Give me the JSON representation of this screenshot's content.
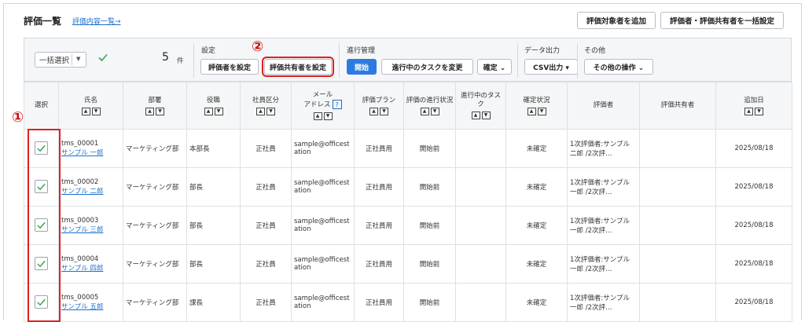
{
  "header": {
    "title": "評価一覧",
    "link": "評価内容一覧→",
    "add_targets_button": "評価対象者を追加",
    "bulk_settings_button": "評価者・評価共有者を一括設定"
  },
  "toolbar": {
    "bulk_select": "一括選択",
    "count": "5",
    "count_unit": "件",
    "settings_label": "設定",
    "set_evaluator_button": "評価者を設定",
    "set_sharer_button": "評価共有者を設定",
    "progress_label": "進行管理",
    "start_button": "開始",
    "change_task_button": "進行中のタスクを変更",
    "confirm_button": "確定 ⌄",
    "data_output_label": "データ出力",
    "csv_button": "CSV出力 ▾",
    "other_label": "その他",
    "other_ops_button": "その他の操作 ⌄"
  },
  "markers": {
    "one": "①",
    "two": "②"
  },
  "columns": {
    "select": "選択",
    "name": "氏名",
    "dept": "部署",
    "position": "役職",
    "emp_type": "社員区分",
    "email_a": "メール",
    "email_b": "アドレス",
    "plan": "評価プラン",
    "eval_status": "評価の進行状況",
    "task": "進行中のタスク",
    "confirm_status": "確定状況",
    "evaluator": "評価者",
    "sharer": "評価共有者",
    "added_date": "追加日"
  },
  "rows": [
    {
      "id": "tms_00001",
      "name": "サンプル 一郎",
      "dept": "マーケティング部",
      "position": "本部長",
      "emp_type": "正社員",
      "email": "sample@officestation",
      "plan": "正社員用",
      "eval_status": "開始前",
      "task": "",
      "confirm": "未確定",
      "evaluator": "1次評価者:サンプル 二郎 /2次評…",
      "sharer": "",
      "added": "2025/08/18"
    },
    {
      "id": "tms_00002",
      "name": "サンプル 二郎",
      "dept": "マーケティング部",
      "position": "部長",
      "emp_type": "正社員",
      "email": "sample@officestation",
      "plan": "正社員用",
      "eval_status": "開始前",
      "task": "",
      "confirm": "未確定",
      "evaluator": "1次評価者:サンプル 一郎 /2次評…",
      "sharer": "",
      "added": "2025/08/18"
    },
    {
      "id": "tms_00003",
      "name": "サンプル 三郎",
      "dept": "マーケティング部",
      "position": "部長",
      "emp_type": "正社員",
      "email": "sample@officestation",
      "plan": "正社員用",
      "eval_status": "開始前",
      "task": "",
      "confirm": "未確定",
      "evaluator": "1次評価者:サンプル 一郎 /2次評…",
      "sharer": "",
      "added": "2025/08/18"
    },
    {
      "id": "tms_00004",
      "name": "サンプル 四郎",
      "dept": "マーケティング部",
      "position": "部長",
      "emp_type": "正社員",
      "email": "sample@officestation",
      "plan": "正社員用",
      "eval_status": "開始前",
      "task": "",
      "confirm": "未確定",
      "evaluator": "1次評価者:サンプル 一郎 /2次評…",
      "sharer": "",
      "added": "2025/08/18"
    },
    {
      "id": "tms_00005",
      "name": "サンプル 五郎",
      "dept": "マーケティング部",
      "position": "課長",
      "emp_type": "正社員",
      "email": "sample@officestation",
      "plan": "正社員用",
      "eval_status": "開始前",
      "task": "",
      "confirm": "未確定",
      "evaluator": "1次評価者:サンプル 一郎 /2次評…",
      "sharer": "",
      "added": "2025/08/18"
    }
  ],
  "colors": {
    "accent": "#2d7be0",
    "highlight": "#e02020",
    "check": "#2fa84f",
    "link": "#1a6fc9"
  }
}
